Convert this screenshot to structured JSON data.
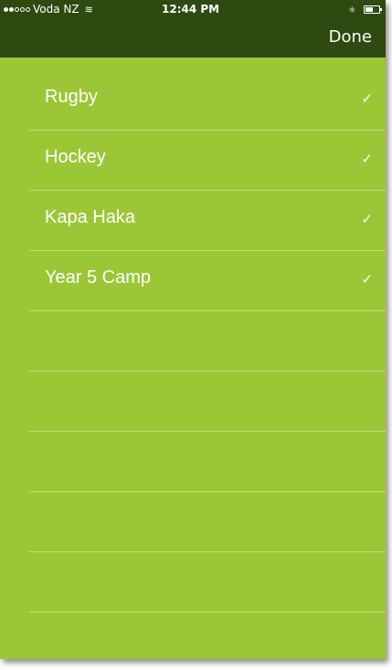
{
  "status_bar": {
    "carrier": "Voda NZ",
    "time": "12:44 PM",
    "signal_bars_filled": 2,
    "signal_bars_total": 5,
    "battery_level": 0.55
  },
  "nav": {
    "done_label": "Done"
  },
  "list": {
    "items": [
      {
        "label": "Rugby",
        "checked": true,
        "check": "✓"
      },
      {
        "label": "Hockey",
        "checked": true,
        "check": "✓"
      },
      {
        "label": "Kapa Haka",
        "checked": true,
        "check": "✓"
      },
      {
        "label": "Year 5 Camp",
        "checked": true,
        "check": "✓"
      }
    ],
    "empty_rows": 6
  },
  "colors": {
    "background": "#9bc737",
    "bar": "#2e4a10",
    "text": "#ffffff"
  },
  "icons": {
    "wifi": "wifi-icon",
    "bluetooth": "bluetooth-icon",
    "battery": "battery-icon",
    "check": "checkmark-icon"
  }
}
